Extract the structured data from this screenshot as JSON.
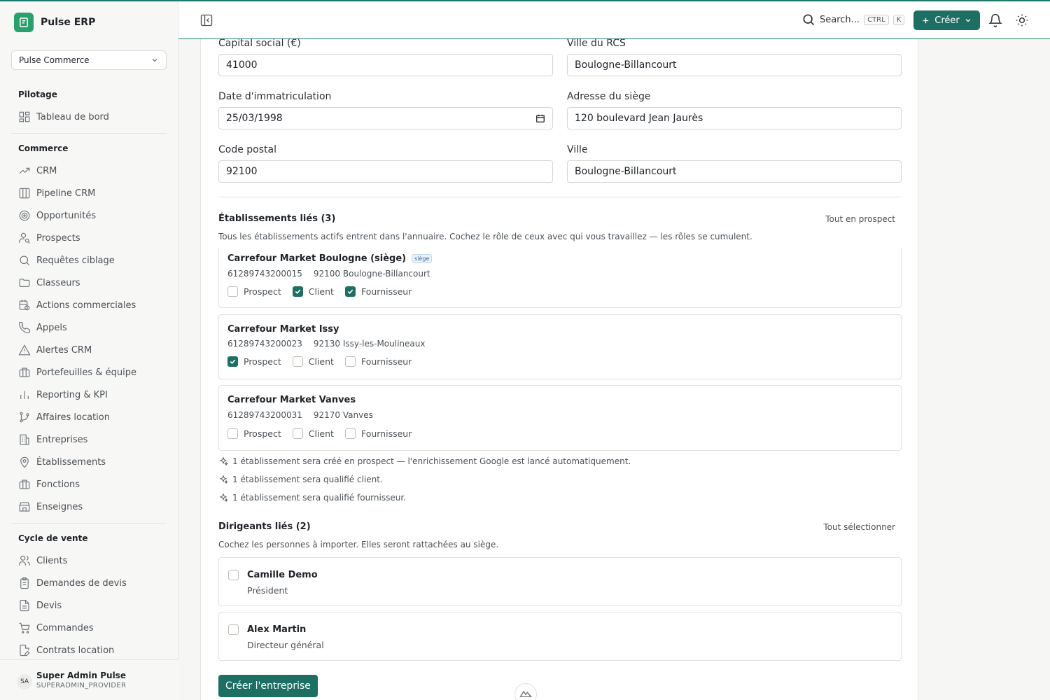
{
  "app": {
    "name": "Pulse ERP",
    "accent": "#1d6f63"
  },
  "sidebar": {
    "org": "Pulse Commerce",
    "sections": [
      {
        "title": "Pilotage",
        "items": [
          {
            "label": "Tableau de bord",
            "icon": "dashboard-icon"
          }
        ]
      },
      {
        "title": "Commerce",
        "items": [
          {
            "label": "CRM",
            "icon": "trend-icon"
          },
          {
            "label": "Pipeline CRM",
            "icon": "columns-icon"
          },
          {
            "label": "Opportunités",
            "icon": "target-icon"
          },
          {
            "label": "Prospects",
            "icon": "user-search-icon"
          },
          {
            "label": "Requêtes ciblage",
            "icon": "search-icon"
          },
          {
            "label": "Classeurs",
            "icon": "folder-icon"
          },
          {
            "label": "Actions commerciales",
            "icon": "calendar-clock-icon"
          },
          {
            "label": "Appels",
            "icon": "phone-icon"
          },
          {
            "label": "Alertes CRM",
            "icon": "alert-icon"
          },
          {
            "label": "Portefeuilles & équipe",
            "icon": "briefcase-icon"
          },
          {
            "label": "Reporting & KPI",
            "icon": "bar-chart-icon"
          },
          {
            "label": "Affaires location",
            "icon": "git-branch-icon"
          },
          {
            "label": "Entreprises",
            "icon": "building-icon"
          },
          {
            "label": "Établissements",
            "icon": "map-pin-icon"
          },
          {
            "label": "Fonctions",
            "icon": "briefcase-icon"
          },
          {
            "label": "Enseignes",
            "icon": "store-icon"
          }
        ]
      },
      {
        "title": "Cycle de vente",
        "items": [
          {
            "label": "Clients",
            "icon": "users-icon"
          },
          {
            "label": "Demandes de devis",
            "icon": "clipboard-icon"
          },
          {
            "label": "Devis",
            "icon": "file-text-icon"
          },
          {
            "label": "Commandes",
            "icon": "cart-icon"
          },
          {
            "label": "Contrats location",
            "icon": "file-edit-icon"
          }
        ]
      }
    ],
    "user": {
      "initials": "SA",
      "name": "Super Admin Pulse",
      "role": "SUPERADMIN_PROVIDER"
    }
  },
  "topbar": {
    "search": "Search...",
    "kbd1": "CTRL",
    "kbd2": "K",
    "create": "Créer"
  },
  "form": {
    "fields": [
      {
        "label": "Capital social (€)",
        "value": "41000"
      },
      {
        "label": "Ville du RCS",
        "value": "Boulogne-Billancourt"
      },
      {
        "label": "Date d'immatriculation",
        "value": "25/03/1998"
      },
      {
        "label": "Adresse du siège",
        "value": "120 boulevard Jean Jaurès"
      },
      {
        "label": "Code postal",
        "value": "92100"
      },
      {
        "label": "Ville",
        "value": "Boulogne-Billancourt"
      }
    ]
  },
  "establishments": {
    "title": "Établissements liés (3)",
    "action": "Tout en prospect",
    "desc": "Tous les établissements actifs entrent dans l'annuaire. Cochez le rôle de ceux avec qui vous travaillez — les rôles se cumulent.",
    "role_labels": [
      "Prospect",
      "Client",
      "Fournisseur"
    ],
    "items": [
      {
        "name": "Carrefour Market Boulogne (siège)",
        "badge": "siège",
        "siret": "61289743200015",
        "address": "92100 Boulogne-Billancourt",
        "roles": [
          false,
          true,
          true
        ]
      },
      {
        "name": "Carrefour Market Issy",
        "siret": "61289743200023",
        "address": "92130 Issy-les-Moulineaux",
        "roles": [
          true,
          false,
          false
        ]
      },
      {
        "name": "Carrefour Market Vanves",
        "siret": "61289743200031",
        "address": "92170 Vanves",
        "roles": [
          false,
          false,
          false
        ]
      }
    ],
    "notes": [
      "1 établissement sera créé en prospect — l'enrichissement Google est lancé automatiquement.",
      "1 établissement sera qualifié client.",
      "1 établissement sera qualifié fournisseur."
    ]
  },
  "leaders": {
    "title": "Dirigeants liés (2)",
    "action": "Tout sélectionner",
    "desc": "Cochez les personnes à importer. Elles seront rattachées au siège.",
    "items": [
      {
        "name": "Camille Demo",
        "role": "Président"
      },
      {
        "name": "Alex Martin",
        "role": "Directeur général"
      }
    ]
  },
  "submit": "Créer l'entreprise"
}
